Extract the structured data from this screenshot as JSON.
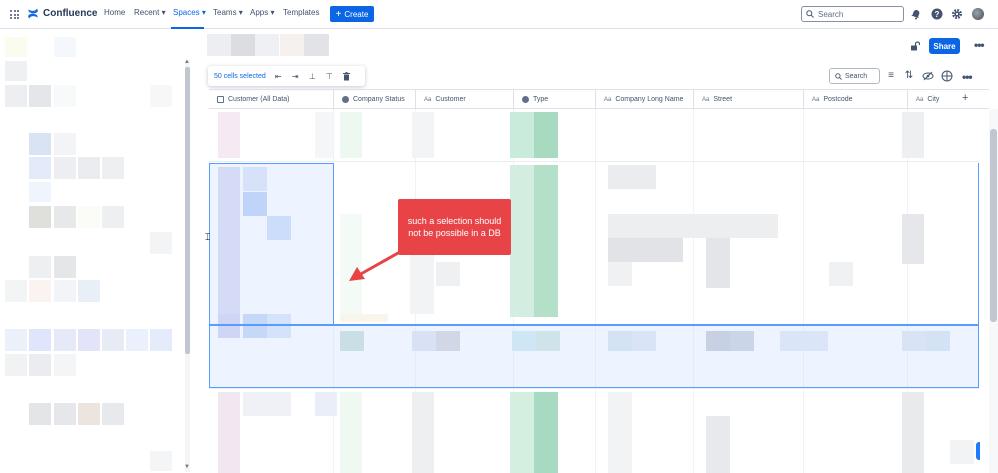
{
  "nav": {
    "brand": "Confluence",
    "items": [
      "Home",
      "Recent",
      "Spaces",
      "Teams",
      "Apps",
      "Templates"
    ],
    "create_label": "Create",
    "search_placeholder": "Search"
  },
  "page": {
    "share_label": "Share"
  },
  "selection_toolbar": {
    "count_label": "50 cells selected"
  },
  "database": {
    "search_label": "Search",
    "columns": [
      "Customer (All Data)",
      "Company Status",
      "Customer",
      "Type",
      "Company Long Name",
      "Street",
      "Postcode",
      "City"
    ]
  },
  "annotation": {
    "text": "such a selection should not be possible in a DB",
    "color": "#e84447"
  },
  "colors": {
    "brand": "#0c66e4",
    "selection_border": "#579dff"
  }
}
